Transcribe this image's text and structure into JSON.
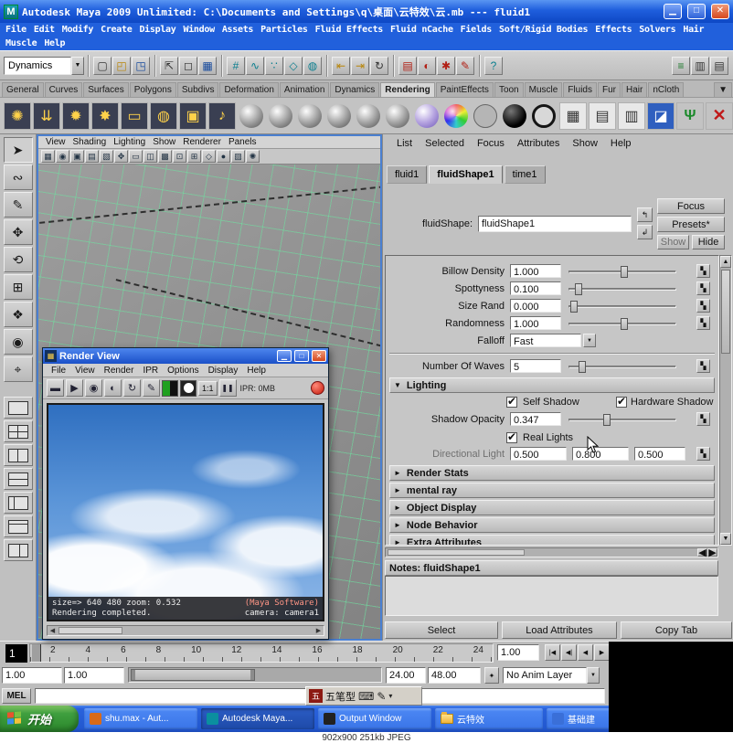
{
  "window": {
    "title": "Autodesk Maya 2009 Unlimited: C:\\Documents and Settings\\q\\桌面\\云特效\\云.mb --- fluid1"
  },
  "icons": {
    "maya_app": "M",
    "minimize": "▁",
    "maximize": "□",
    "close": "✕",
    "dropdown": "▼",
    "map": "▚",
    "up": "▲",
    "down": "▼",
    "left": "◀",
    "right": "▶",
    "focus_in": "↰",
    "focus_out": "↲",
    "pause": "❚❚",
    "expanded": "▼",
    "collapsed": "►"
  },
  "menubar": {
    "row1": [
      "File",
      "Edit",
      "Modify",
      "Create",
      "Display",
      "Window",
      "Assets",
      "Particles",
      "Fluid Effects",
      "Fluid nCache",
      "Fields",
      "Soft/Rigid Bodies",
      "Effects",
      "Solvers",
      "Hair"
    ],
    "row2": [
      "Muscle",
      "Help"
    ]
  },
  "statusline": {
    "mode_selector": "Dynamics",
    "icons": [
      {
        "name": "file-new-icon",
        "glyph": "▢"
      },
      {
        "name": "file-open-icon",
        "glyph": "◰"
      },
      {
        "name": "file-save-icon",
        "glyph": "◳"
      },
      {
        "name": "select-hierarchy-icon",
        "glyph": "⇱"
      },
      {
        "name": "select-object-icon",
        "glyph": "◻"
      },
      {
        "name": "select-component-icon",
        "glyph": "▦"
      },
      {
        "name": "snap-grid-icon",
        "glyph": "#"
      },
      {
        "name": "snap-curve-icon",
        "glyph": "∿"
      },
      {
        "name": "snap-point-icon",
        "glyph": "∵"
      },
      {
        "name": "snap-plane-icon",
        "glyph": "◇"
      },
      {
        "name": "make-live-icon",
        "glyph": "◍"
      },
      {
        "name": "input-connections-icon",
        "glyph": "⇤"
      },
      {
        "name": "output-connections-icon",
        "glyph": "⇥"
      },
      {
        "name": "construction-history-icon",
        "glyph": "↻"
      },
      {
        "name": "render-frame-icon",
        "glyph": "▤"
      },
      {
        "name": "ipr-render-icon",
        "glyph": "◐"
      },
      {
        "name": "render-settings-icon",
        "glyph": "✱"
      },
      {
        "name": "paint-effects-icon",
        "glyph": "✎"
      },
      {
        "name": "help-line-icon",
        "glyph": "?"
      },
      {
        "name": "counts-icon",
        "glyph": "≡"
      },
      {
        "name": "channel-box-icon",
        "glyph": "▥"
      },
      {
        "name": "layer-editor-icon",
        "glyph": "▤"
      }
    ]
  },
  "shelf": {
    "tabs": [
      "General",
      "Curves",
      "Surfaces",
      "Polygons",
      "Subdivs",
      "Deformation",
      "Animation",
      "Dynamics",
      "Rendering",
      "PaintEffects",
      "Toon",
      "Muscle",
      "Fluids",
      "Fur",
      "Hair",
      "nCloth"
    ],
    "active_tab": "Rendering",
    "glyph_items": [
      {
        "name": "ambient-light-icon",
        "glyph": "✺"
      },
      {
        "name": "directional-light-icon",
        "glyph": "⇊"
      },
      {
        "name": "point-light-icon",
        "glyph": "✹"
      },
      {
        "name": "spot-light-icon",
        "glyph": "✸"
      },
      {
        "name": "area-light-icon",
        "glyph": "▭"
      },
      {
        "name": "volume-light-icon",
        "glyph": "◍"
      },
      {
        "name": "camera-icon",
        "glyph": "▣"
      },
      {
        "name": "paint-effects-note-icon",
        "glyph": "♪"
      },
      {
        "name": "render-globals-icon",
        "glyph": "▦"
      },
      {
        "name": "render-layer-icon",
        "glyph": "▤"
      },
      {
        "name": "batch-render-icon",
        "glyph": "▥"
      },
      {
        "name": "clapper-icon",
        "glyph": "◪"
      },
      {
        "name": "fcheck-icon",
        "glyph": "Ψ"
      },
      {
        "name": "delete-unused-icon",
        "glyph": "✕"
      }
    ]
  },
  "toolbox": {
    "tools": [
      {
        "name": "select-tool",
        "glyph": "➤"
      },
      {
        "name": "lasso-tool",
        "glyph": "∾"
      },
      {
        "name": "paint-select-tool",
        "glyph": "✎"
      },
      {
        "name": "move-tool",
        "glyph": "✥"
      },
      {
        "name": "rotate-tool",
        "glyph": "⟲"
      },
      {
        "name": "scale-tool",
        "glyph": "⊞"
      },
      {
        "name": "universal-manipulator-tool",
        "glyph": "❖"
      },
      {
        "name": "soft-mod-tool",
        "glyph": "◉"
      },
      {
        "name": "show-manipulator-tool",
        "glyph": "⌖"
      }
    ]
  },
  "viewport": {
    "menus": [
      "View",
      "Shading",
      "Lighting",
      "Show",
      "Renderer",
      "Panels"
    ],
    "bar_icons": [
      {
        "name": "select-camera-icon",
        "glyph": "▦"
      },
      {
        "name": "lock-camera-icon",
        "glyph": "◉"
      },
      {
        "name": "camera-attributes-icon",
        "glyph": "▣"
      },
      {
        "name": "bookmarks-icon",
        "glyph": "▤"
      },
      {
        "name": "image-plane-icon",
        "glyph": "▧"
      },
      {
        "name": "two-d-pan-icon",
        "glyph": "✥"
      },
      {
        "name": "film-gate-icon",
        "glyph": "▭"
      },
      {
        "name": "resolution-gate-icon",
        "glyph": "◫"
      },
      {
        "name": "gate-mask-icon",
        "glyph": "▩"
      },
      {
        "name": "safe-action-icon",
        "glyph": "⊡"
      },
      {
        "name": "safe-title-icon",
        "glyph": "⊞"
      },
      {
        "name": "wireframe-icon",
        "glyph": "◇"
      },
      {
        "name": "shaded-icon",
        "glyph": "●"
      },
      {
        "name": "textured-icon",
        "glyph": "▨"
      },
      {
        "name": "lights-icon",
        "glyph": "✺"
      }
    ]
  },
  "render_view": {
    "title": "Render View",
    "menus": [
      "File",
      "View",
      "Render",
      "IPR",
      "Options",
      "Display",
      "Help"
    ],
    "toolbar": [
      {
        "name": "render-clapper-icon",
        "glyph": "▬"
      },
      {
        "name": "redo-render-icon",
        "glyph": "▶"
      },
      {
        "name": "snapshot-icon",
        "glyph": "◉"
      },
      {
        "name": "ipr-render-icon",
        "glyph": "◐"
      },
      {
        "name": "refresh-shading-icon",
        "glyph": "↻"
      },
      {
        "name": "pencil-region-icon",
        "glyph": "✎"
      }
    ],
    "zoom_label": "1:1",
    "ipr_memory": "IPR: 0MB",
    "status_line1_left": "size=> 640 480  zoom: 0.532",
    "status_line1_right": "(Maya Software)",
    "status_line2_left": "Rendering completed.",
    "status_line2_right": "camera: camera1"
  },
  "attribute_editor": {
    "menus": [
      "List",
      "Selected",
      "Focus",
      "Attributes",
      "Show",
      "Help"
    ],
    "tabs": [
      "fluid1",
      "fluidShape1",
      "time1"
    ],
    "active_tab": "fluidShape1",
    "node_label": "fluidShape:",
    "node_value": "fluidShape1",
    "focus_button": "Focus",
    "presets_button": "Presets*",
    "show_button": "Show",
    "hide_button": "Hide",
    "rows": [
      {
        "label": "Billow Density",
        "value": "1.000"
      },
      {
        "label": "Spottyness",
        "value": "0.100"
      },
      {
        "label": "Size Rand",
        "value": "0.000"
      },
      {
        "label": "Randomness",
        "value": "1.000"
      }
    ],
    "falloff_label": "Falloff",
    "falloff_value": "Fast",
    "waves_label": "Number Of Waves",
    "waves_value": "5",
    "lighting_header": "Lighting",
    "self_shadow_label": "Self Shadow",
    "hardware_shadow_label": "Hardware Shadow",
    "shadow_opacity_label": "Shadow Opacity",
    "shadow_opacity_value": "0.347",
    "real_lights_label": "Real Lights",
    "directional_light_label": "Directional Light",
    "directional_values": [
      "0.500",
      "0.800",
      "0.500"
    ],
    "sections": [
      "Render Stats",
      "mental ray",
      "Object Display",
      "Node Behavior",
      "Extra Attributes"
    ],
    "notes_header": "Notes: fluidShape1",
    "footer_buttons": [
      "Select",
      "Load Attributes",
      "Copy Tab"
    ]
  },
  "timeline": {
    "current_frame": "1",
    "ticks": [
      "2",
      "4",
      "6",
      "8",
      "10",
      "12",
      "14",
      "16",
      "18",
      "20",
      "22",
      "24"
    ],
    "time_field": "1.00",
    "playback": [
      {
        "name": "go-to-start-button",
        "glyph": "|◀"
      },
      {
        "name": "step-back-button",
        "glyph": "◀|"
      },
      {
        "name": "play-backward-button",
        "glyph": "◀"
      },
      {
        "name": "play-forward-button",
        "glyph": "▶"
      }
    ]
  },
  "range_slider": {
    "start": "1.00",
    "range_start": "1.00",
    "range_end": "24.00",
    "end": "48.00",
    "anim_layer": "No Anim Layer"
  },
  "command_line": {
    "label": "MEL"
  },
  "ime_bar": {
    "label": "五笔型"
  },
  "taskbar": {
    "start_label": "开始",
    "tasks": [
      {
        "label": "shu.max - Aut..."
      },
      {
        "label": "Autodesk Maya..."
      },
      {
        "label": "Output Window"
      },
      {
        "label": "云特效"
      },
      {
        "label": "基础建"
      }
    ]
  },
  "status_bar": {
    "text": "902x900 251kb JPEG"
  }
}
